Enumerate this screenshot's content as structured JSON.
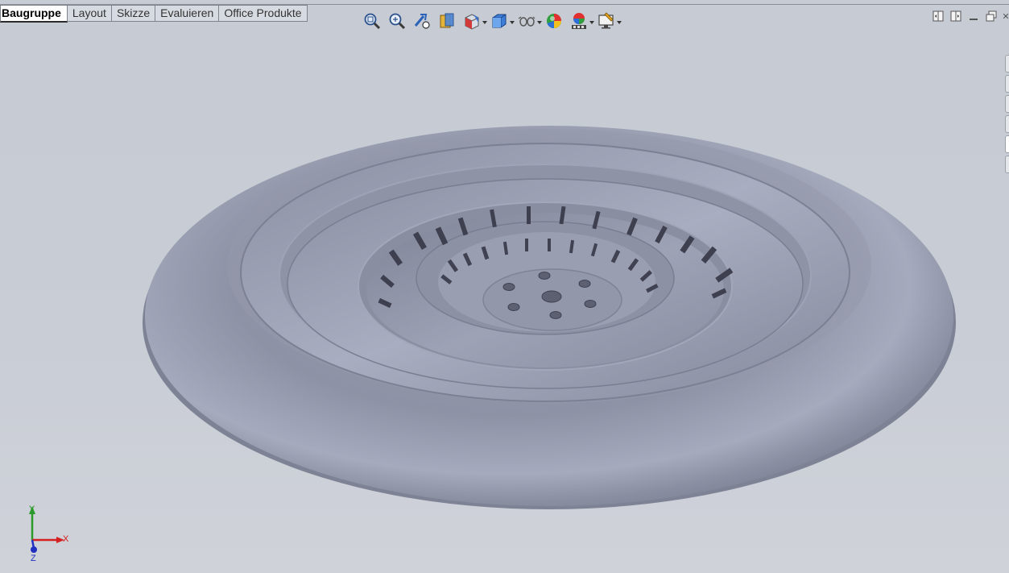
{
  "tabs": [
    {
      "label": "Baugruppe",
      "active": true
    },
    {
      "label": "Layout"
    },
    {
      "label": "Skizze"
    },
    {
      "label": "Evaluieren"
    },
    {
      "label": "Office Produkte"
    }
  ],
  "toolbar_icons": [
    "zoom-to-fit-icon",
    "zoom-to-area-icon",
    "previous-view-icon",
    "section-view-icon",
    "view-orientation-icon",
    "display-style-icon",
    "hide-show-items-icon",
    "edit-appearance-icon",
    "apply-scene-icon",
    "view-settings-icon"
  ],
  "window_controls": [
    "tile-horizontal-icon",
    "tile-vertical-icon",
    "minimize-icon",
    "restore-icon",
    "close-icon"
  ],
  "triad": {
    "x": "X",
    "y": "Y",
    "z": "Z"
  },
  "colors": {
    "model": "#8d92a5",
    "background": "#c8ccd4",
    "x_axis": "#d42020",
    "y_axis": "#2b9a2b",
    "z_axis": "#2030c0"
  }
}
